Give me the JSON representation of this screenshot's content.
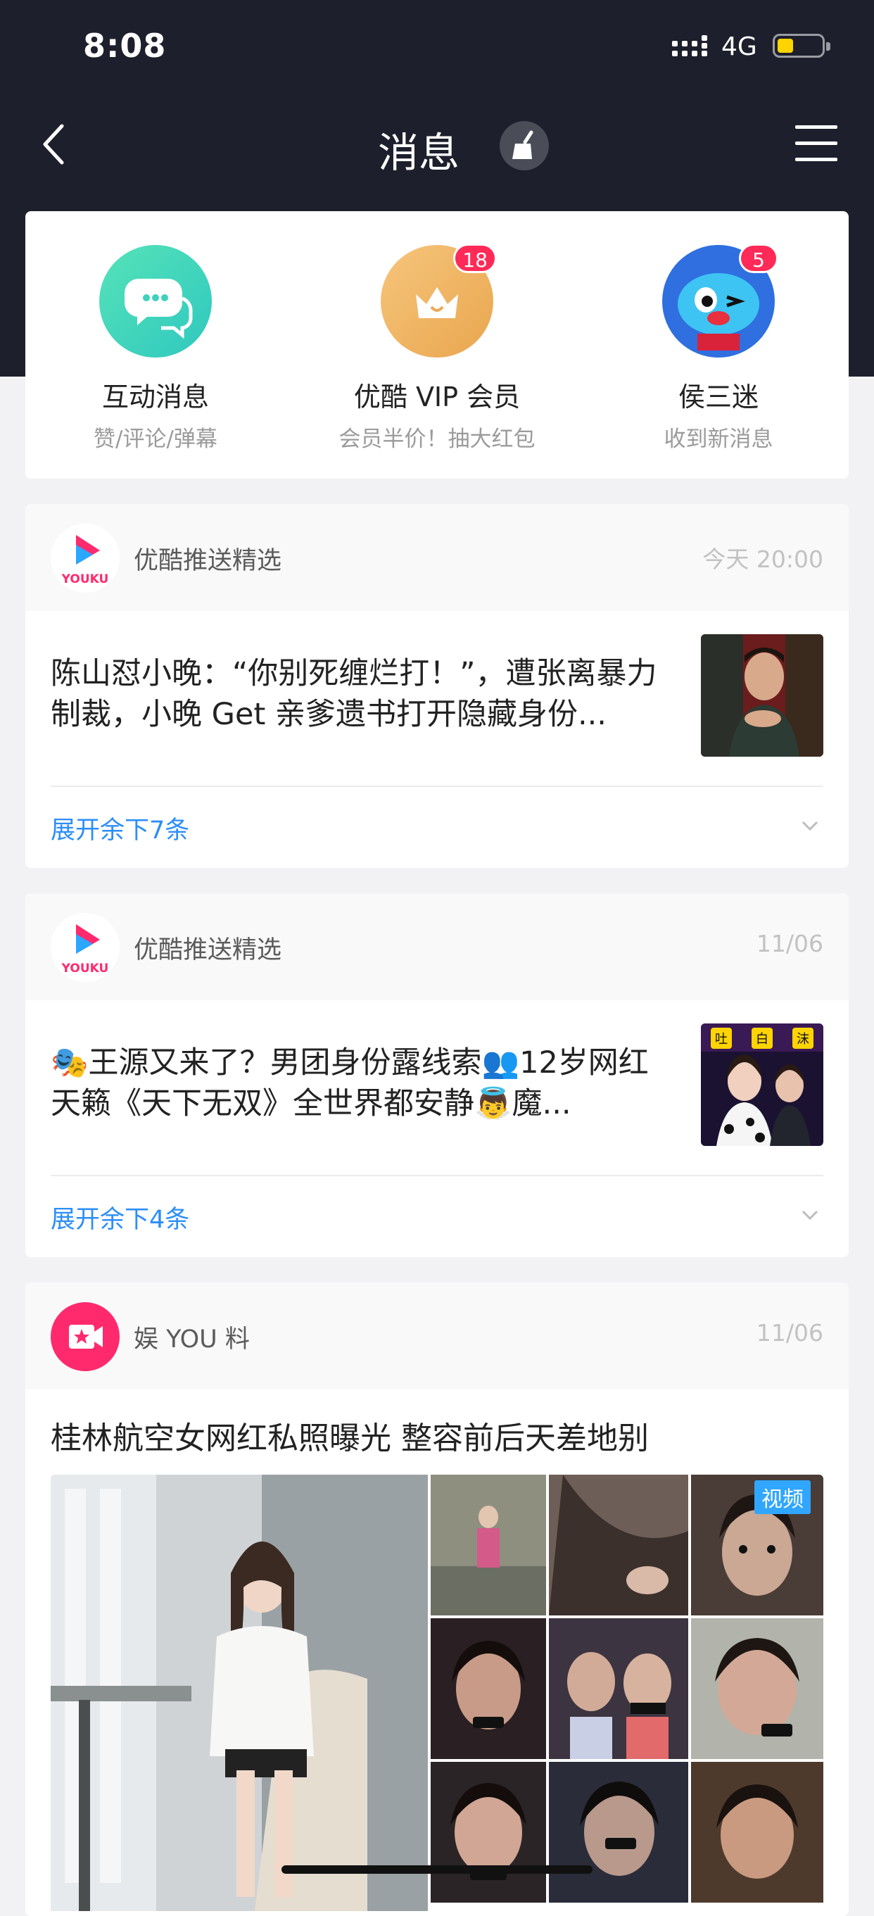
{
  "status_bar": {
    "time": "8:08",
    "network": "4G"
  },
  "nav": {
    "title": "消息"
  },
  "quick_actions": [
    {
      "label": "互动消息",
      "sub": "赞/评论/弹幕",
      "badge": ""
    },
    {
      "label": "优酷 VIP 会员",
      "sub": "会员半价！抽大红包",
      "badge": "18"
    },
    {
      "label": "侯三迷",
      "sub": "收到新消息",
      "badge": "5"
    }
  ],
  "feeds": [
    {
      "source": "优酷推送精选",
      "logo_text": "YOUKU",
      "date": "今天 20:00",
      "text": "陈山怼小晚：“你别死缠烂打！”，遭张离暴力制裁，小晚 Get 亲爹遗书打开隐藏身份...",
      "more": "展开余下7条"
    },
    {
      "source": "优酷推送精选",
      "logo_text": "YOUKU",
      "date": "11/06",
      "text": "🎭王源又来了？男团身份露线索👥12岁网红天籁《天下无双》全世界都安静👼魔...",
      "more": "展开余下4条"
    }
  ],
  "thumb2_caption": [
    "吐",
    "白",
    "沫"
  ],
  "entertainment": {
    "source": "娱 YOU 料",
    "date": "11/06",
    "title": "桂林航空女网红私照曝光 整容前后天差地别",
    "video_label": "视频"
  },
  "colors": {
    "header_bg": "#1d1f2c",
    "link": "#2c8ef8",
    "badge": "#ff2a57"
  }
}
